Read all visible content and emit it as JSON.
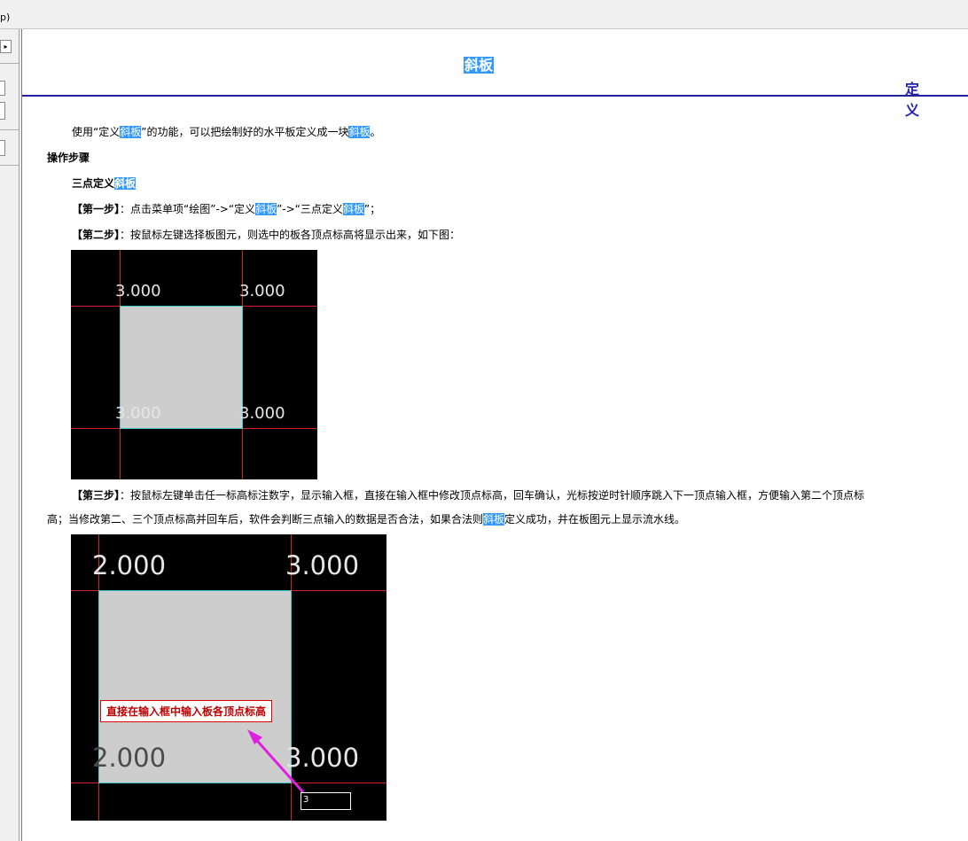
{
  "window": {
    "menu_fragment": "p)"
  },
  "sidebar": {
    "arrow_label": "▸"
  },
  "doc": {
    "title_pre": "定义",
    "title_hl": "斜板",
    "intro": {
      "a": "使用“定义",
      "hl1": "斜板",
      "b": "”的功能，可以把绘制好的水平板定义成一块",
      "hl2": "斜板",
      "c": "。"
    },
    "section_heading": "操作步骤",
    "subheading": {
      "a": "三点定义",
      "hl": "斜板"
    },
    "step1": {
      "label": "【第一步】",
      "a": "：点击菜单项“绘图”->“定义",
      "hl1": "斜板",
      "b": "”->“三点定义",
      "hl2": "斜板",
      "c": "”；"
    },
    "step2": {
      "label": "【第二步】",
      "a": "：按鼠标左键选择板图元，则选中的板各顶点标高将显示出来，如下图："
    },
    "step3": {
      "label": "【第三步】",
      "line1": "：按鼠标左键单击任一标高标注数字，显示输入框，直接在输入框中修改顶点标高，回车确认，光标按逆时针顺序跳入下一顶点输入框，方便输入第二个顶点标",
      "line2a": "高；当修改第二、三个顶点标高并回车后，软件会判断三点输入的数据是否合法，如果合法则",
      "hl": "斜板",
      "line2b": "定义成功，并在板图元上显示流水线。"
    },
    "figure1": {
      "tl": "3.000",
      "tr": "3.000",
      "bl": "3.000",
      "br": "3.000"
    },
    "figure2": {
      "tl": "2.000",
      "tr": "3.000",
      "bl": "2.000",
      "br": "3.000",
      "callout": "直接在输入框中输入板各顶点标高",
      "input_value": "3"
    }
  }
}
